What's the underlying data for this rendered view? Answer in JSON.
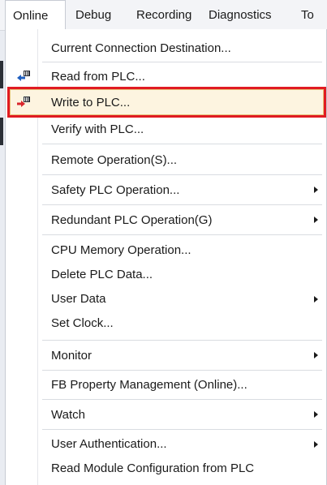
{
  "menubar": {
    "items": [
      "Online",
      "Debug",
      "Recording",
      "Diagnostics",
      "To"
    ]
  },
  "dropdown": {
    "items": [
      {
        "label": "Current Connection Destination...",
        "submenu": false
      },
      {
        "label": "Read from PLC...",
        "submenu": false,
        "icon": "read-from-plc-icon"
      },
      {
        "label": "Write to PLC...",
        "submenu": false,
        "icon": "write-to-plc-icon",
        "highlighted": true
      },
      {
        "label": "Verify with PLC...",
        "submenu": false
      },
      {
        "label": "Remote Operation(S)...",
        "submenu": false
      },
      {
        "label": "Safety PLC Operation...",
        "submenu": true
      },
      {
        "label": "Redundant PLC Operation(G)",
        "submenu": true
      },
      {
        "label": "CPU Memory Operation...",
        "submenu": false
      },
      {
        "label": "Delete PLC Data...",
        "submenu": false
      },
      {
        "label": "User Data",
        "submenu": true
      },
      {
        "label": "Set Clock...",
        "submenu": false
      },
      {
        "label": "Monitor",
        "submenu": true
      },
      {
        "label": "FB Property Management (Online)...",
        "submenu": false
      },
      {
        "label": "Watch",
        "submenu": true
      },
      {
        "label": "User Authentication...",
        "submenu": true
      },
      {
        "label": "Read Module Configuration from PLC",
        "submenu": false
      }
    ]
  },
  "colors": {
    "highlight_border": "#e01b22",
    "hover_fill": "#fdf4e0",
    "icon_blue": "#1f5fbf",
    "icon_red": "#d9262c"
  }
}
